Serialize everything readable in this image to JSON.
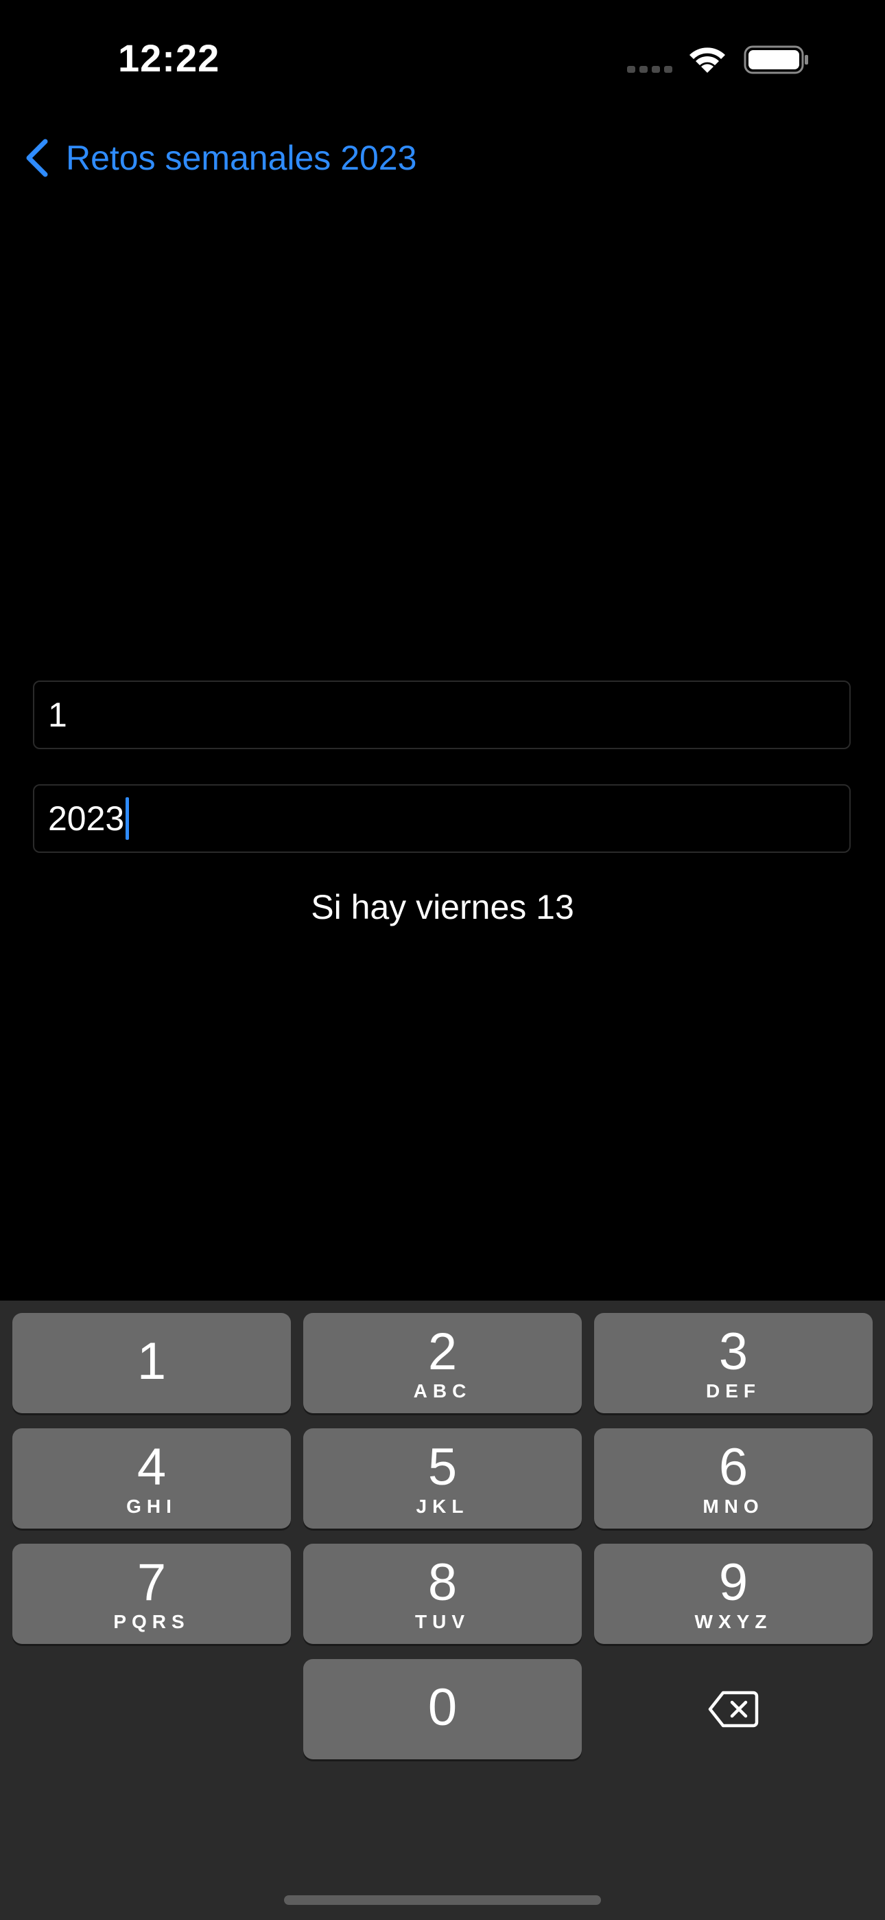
{
  "status_bar": {
    "time": "12:22",
    "icons": [
      "cellular-signal-icon",
      "wifi-icon",
      "battery-icon"
    ]
  },
  "nav": {
    "back_label": "Retos semanales 2023",
    "accent_color": "#2f8cff"
  },
  "form": {
    "field_1_value": "1",
    "field_2_value": "2023",
    "result": "Si hay viernes 13"
  },
  "keyboard": {
    "keys": [
      {
        "digit": "1",
        "letters": ""
      },
      {
        "digit": "2",
        "letters": "ABC"
      },
      {
        "digit": "3",
        "letters": "DEF"
      },
      {
        "digit": "4",
        "letters": "GHI"
      },
      {
        "digit": "5",
        "letters": "JKL"
      },
      {
        "digit": "6",
        "letters": "MNO"
      },
      {
        "digit": "7",
        "letters": "PQRS"
      },
      {
        "digit": "8",
        "letters": "TUV"
      },
      {
        "digit": "9",
        "letters": "WXYZ"
      },
      {
        "digit": "0",
        "letters": ""
      }
    ],
    "delete_icon": "backspace-icon"
  }
}
